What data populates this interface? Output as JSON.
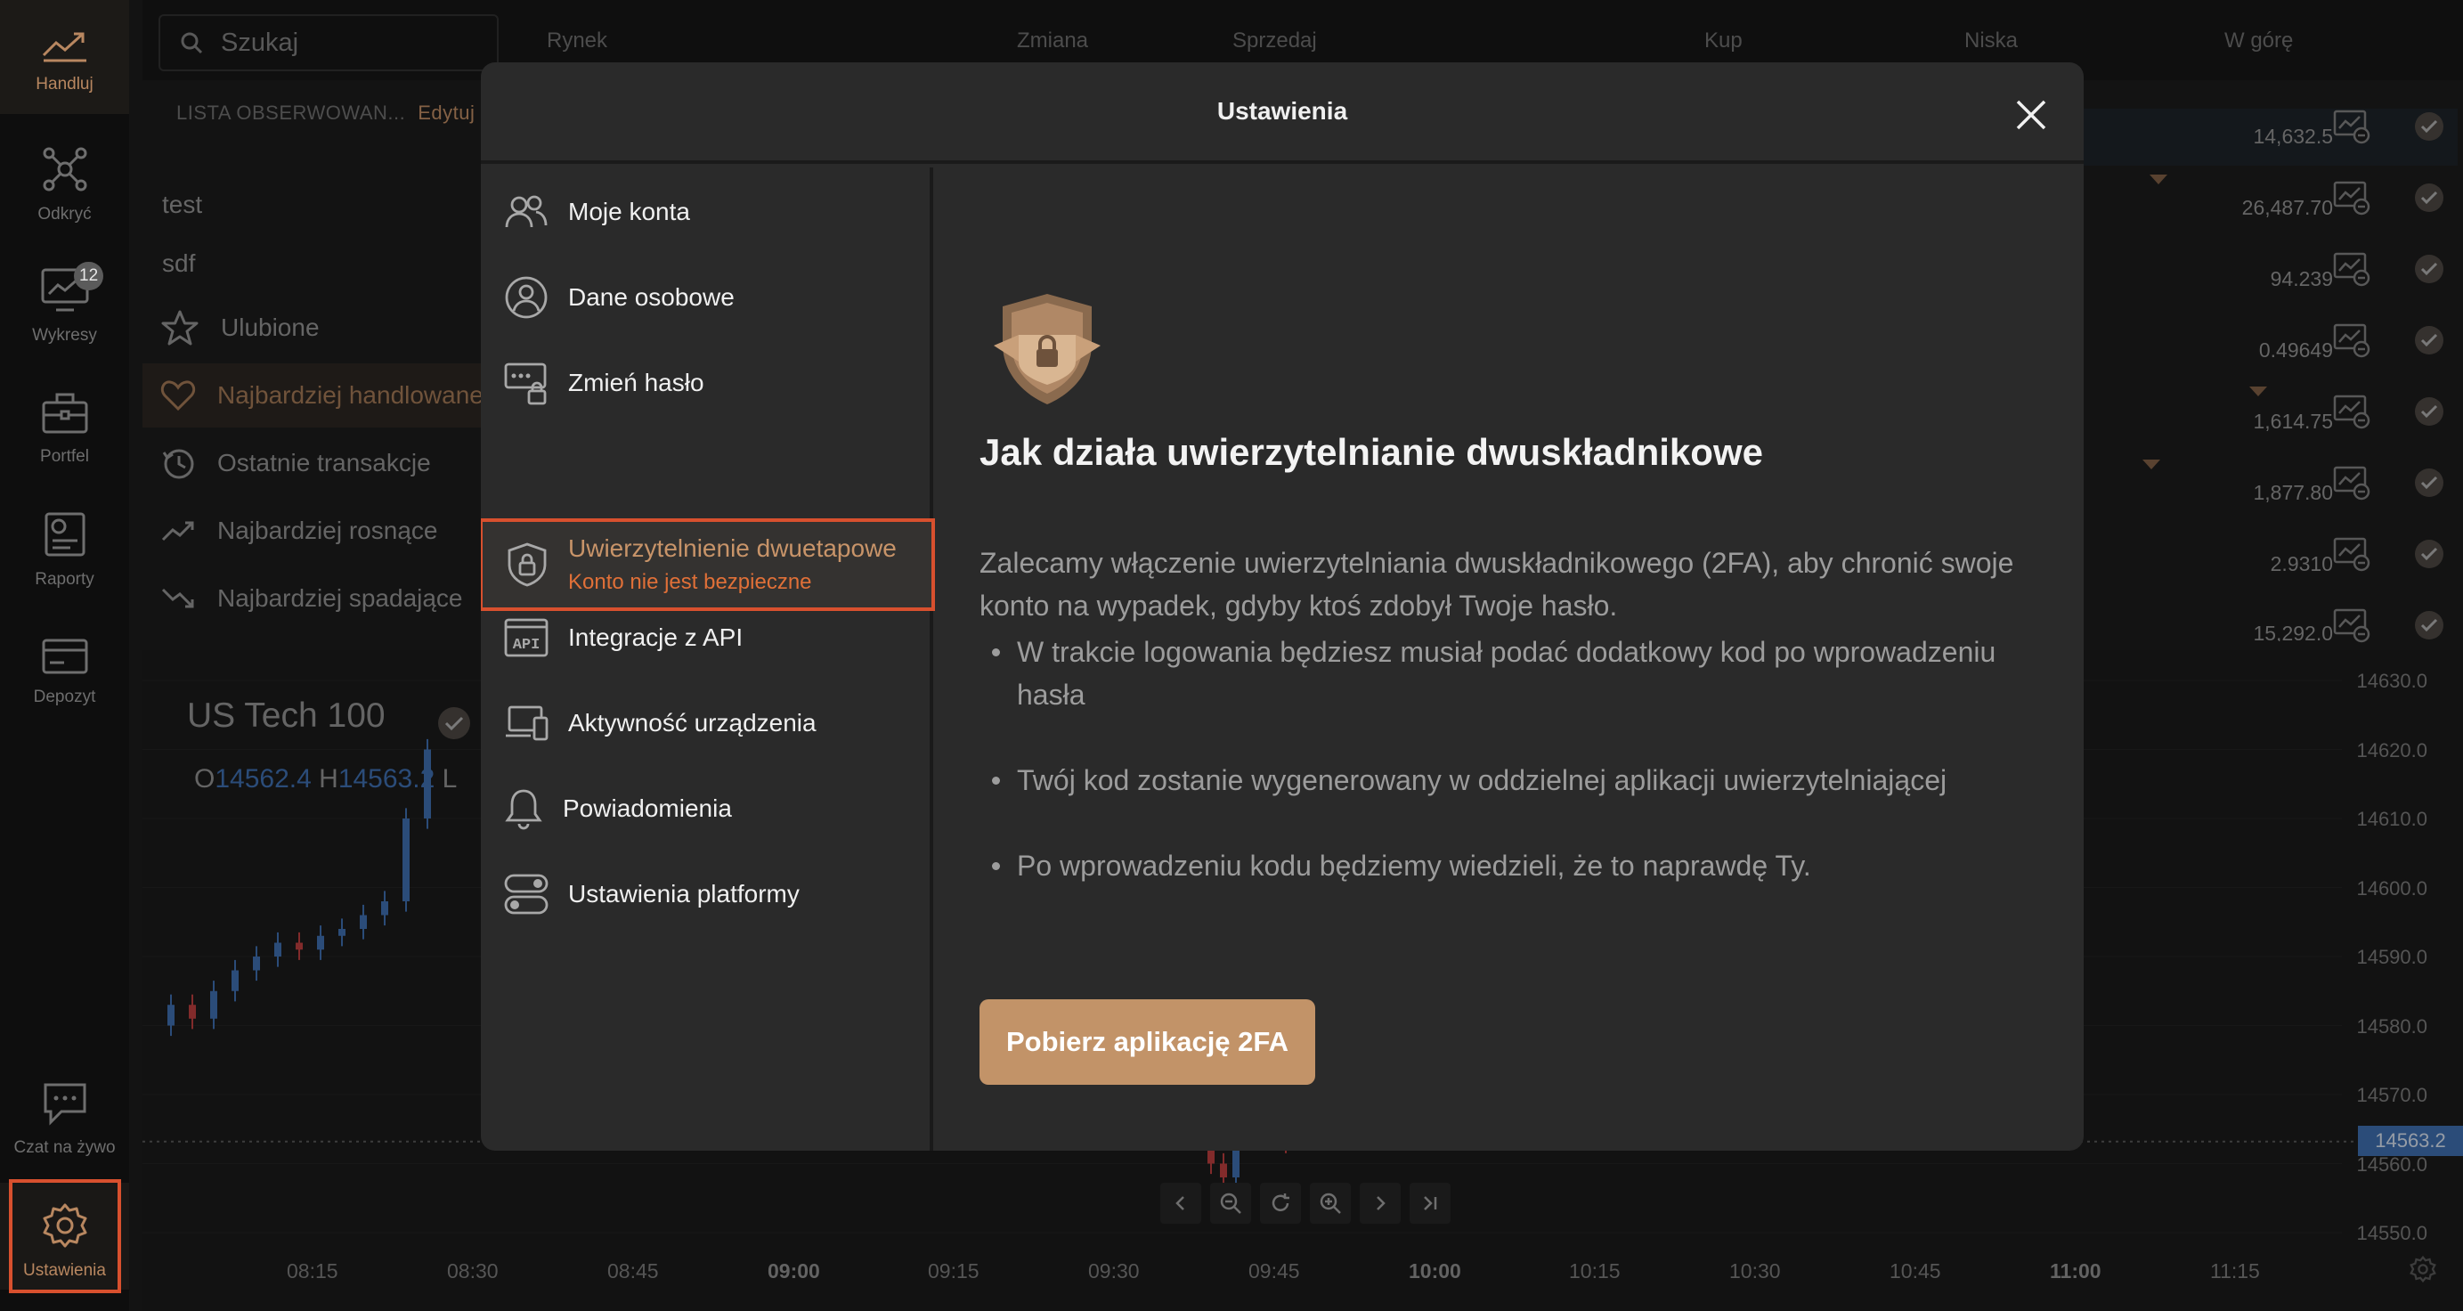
{
  "colors": {
    "accent": "#c29368",
    "highlight": "#d8502e",
    "warning_text": "#e07038",
    "chart_blue": "#3c6aa8",
    "chart_red": "#b43c3c"
  },
  "rail": {
    "items": [
      {
        "label": "Handluj",
        "icon": "trending-up-icon"
      },
      {
        "label": "Odkryć",
        "icon": "network-icon"
      },
      {
        "label": "Wykresy",
        "icon": "chart-monitor-icon",
        "badge": "12"
      },
      {
        "label": "Portfel",
        "icon": "briefcase-icon"
      },
      {
        "label": "Raporty",
        "icon": "report-icon"
      },
      {
        "label": "Depozyt",
        "icon": "card-icon"
      },
      {
        "label": "Czat na żywo",
        "icon": "chat-icon"
      },
      {
        "label": "Ustawienia",
        "icon": "gear-icon"
      }
    ]
  },
  "topbar": {
    "search_placeholder": "Szukaj",
    "columns": [
      "Rynek",
      "Zmiana",
      "Sprzedaj",
      "Kup",
      "Niska",
      "W górę"
    ]
  },
  "watchlist": {
    "header": "LISTA OBSERWOWAN...",
    "edit": "Edytuj",
    "items": [
      "test",
      "sdf",
      "Ulubione",
      "Najbardziej handlowane",
      "Ostatnie transakcje",
      "Najbardziej rosnące",
      "Najbardziej spadające"
    ]
  },
  "quotes": [
    "14,632.5",
    "26,487.70",
    "94.239",
    "0.49649",
    "1,614.75",
    "1,877.80",
    "2.9310",
    "15,292.0"
  ],
  "chart": {
    "title": "US Tech 100",
    "ohl": {
      "o_label": "O",
      "o_value": "14562.4",
      "h_label": "H",
      "h_value": "14563.2",
      "l_label": "L"
    },
    "current_price": "14563.2"
  },
  "chart_data": {
    "type": "line",
    "title": "US Tech 100",
    "x_ticks": [
      "08:15",
      "08:30",
      "08:45",
      "09:00",
      "09:15",
      "09:30",
      "09:45",
      "10:00",
      "10:15",
      "10:30",
      "10:45",
      "11:00",
      "11:15"
    ],
    "y_ticks": [
      "14630.0",
      "14620.0",
      "14610.0",
      "14600.0",
      "14590.0",
      "14580.0",
      "14570.0",
      "14560.0",
      "14550.0"
    ],
    "ylim": [
      14550,
      14630
    ],
    "series": [
      {
        "values": [
          14580,
          14583,
          14581,
          14585,
          14588,
          14590,
          14592,
          14591,
          14593,
          14594,
          14596,
          14598,
          14610,
          14620
        ]
      },
      {
        "values": [
          14568,
          14564,
          14560,
          14558,
          14566,
          14570,
          14565,
          14568,
          14563
        ]
      }
    ]
  },
  "modal": {
    "title": "Ustawienia",
    "menu": [
      {
        "label": "Moje konta",
        "icon": "users-icon"
      },
      {
        "label": "Dane osobowe",
        "icon": "user-circle-icon"
      },
      {
        "label": "Zmień hasło",
        "icon": "password-lock-icon"
      },
      {
        "label": "Uwierzytelnienie dwuetapowe",
        "sub": "Konto nie jest bezpieczne",
        "icon": "shield-lock-icon"
      },
      {
        "label": "Integracje z API",
        "icon": "api-icon"
      },
      {
        "label": "Aktywność urządzenia",
        "icon": "devices-icon"
      },
      {
        "label": "Powiadomienia",
        "icon": "bell-icon"
      },
      {
        "label": "Ustawienia platformy",
        "icon": "toggles-icon"
      }
    ],
    "content": {
      "heading": "Jak działa uwierzytelnianie dwuskładnikowe",
      "intro": "Zalecamy włączenie uwierzytelniania dwuskładnikowego (2FA), aby chronić swoje konto na wypadek, gdyby ktoś zdobył Twoje hasło.",
      "bullets": [
        "W trakcie logowania będziesz musiał podać dodatkowy kod po wprowadzeniu hasła",
        "Twój kod zostanie wygenerowany w oddzielnej aplikacji uwierzytelniającej",
        "Po wprowadzeniu kodu będziemy wiedzieli, że to naprawdę Ty."
      ],
      "button": "Pobierz aplikację 2FA"
    }
  }
}
